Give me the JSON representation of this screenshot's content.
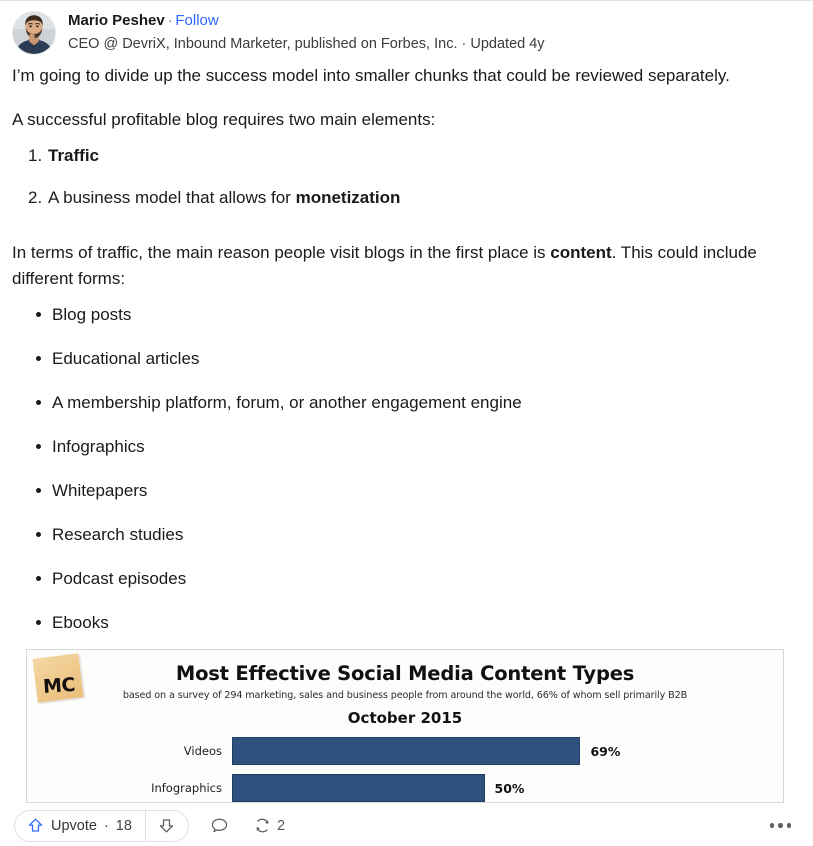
{
  "author": {
    "avatar_icon": "user-avatar-photo",
    "name": "Mario Peshev",
    "separator": "·",
    "follow_label": "Follow",
    "credential": "CEO @ DevriX, Inbound Marketer, published on Forbes, Inc. · Updated 4y",
    "follow_color": "#2e69ff"
  },
  "answer": {
    "paragraph1": "I’m going to divide up the success model into smaller chunks that could be reviewed separately.",
    "paragraph2": "A successful profitable blog requires two main elements:",
    "numbered": [
      {
        "marker": "1.",
        "text": "",
        "bold": "Traffic",
        "after": ""
      },
      {
        "marker": "2.",
        "text": "A business model that allows for ",
        "bold": "monetization",
        "after": ""
      }
    ],
    "paragraph3_pre": "In terms of traffic, the main reason people visit blogs in the first place is ",
    "paragraph3_bold": "content",
    "paragraph3_post": ". This could include different forms:",
    "bullets": [
      "Blog posts",
      "Educational articles",
      "A membership platform, forum, or another engagement engine",
      "Infographics",
      "Whitepapers",
      "Research studies",
      "Podcast episodes",
      "Ebooks"
    ]
  },
  "chart_data": {
    "type": "bar",
    "orientation": "horizontal",
    "logo_text": "MC",
    "title": "Most Effective Social Media Content Types",
    "subtitle": "based on a survey of 294 marketing, sales and business people from around the world, 66% of whom sell primarily B2B",
    "date_label": "October 2015",
    "categories": [
      "Videos",
      "Infographics"
    ],
    "values": [
      69,
      50
    ],
    "value_labels": [
      "69%",
      "50%"
    ],
    "xlabel": "",
    "ylabel": "",
    "xlim": [
      0,
      100
    ],
    "grid": false,
    "legend": "none",
    "bar_color": "#2e5180",
    "note": "chart is cropped at the bottom of the viewport; only the first two bars are visible"
  },
  "actions": {
    "upvote_icon": "upvote-arrow-icon",
    "upvote_label": "Upvote",
    "upvote_separator": "·",
    "upvote_count": "18",
    "downvote_icon": "downvote-arrow-icon",
    "comment_icon": "comment-bubble-icon",
    "share_icon": "repost-arrows-icon",
    "share_count": "2",
    "more_icon": "more-horizontal-icon",
    "upvote_accent": "#2e69ff"
  }
}
